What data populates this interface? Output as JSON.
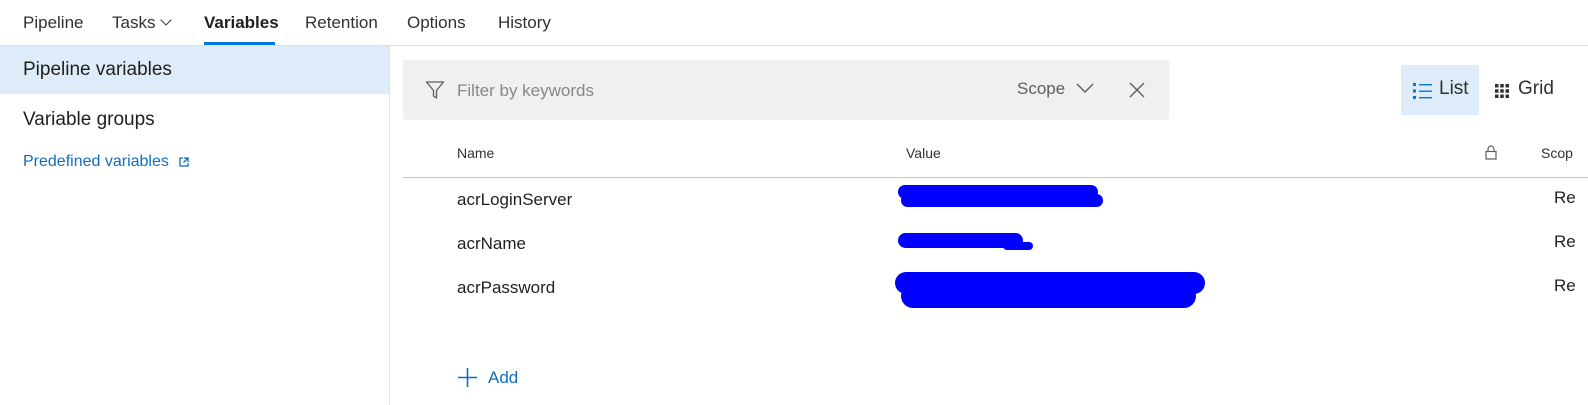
{
  "tabs": [
    {
      "label": "Pipeline"
    },
    {
      "label": "Tasks"
    },
    {
      "label": "Variables"
    },
    {
      "label": "Retention"
    },
    {
      "label": "Options"
    },
    {
      "label": "History"
    }
  ],
  "active_tab": "Variables",
  "sidebar": {
    "items": [
      {
        "label": "Pipeline variables"
      },
      {
        "label": "Variable groups"
      }
    ],
    "predefined_link": "Predefined variables"
  },
  "filter": {
    "placeholder": "Filter by keywords",
    "scope_label": "Scope"
  },
  "view_toggle": {
    "list_label": "List",
    "grid_label": "Grid",
    "selected": "List"
  },
  "table": {
    "headers": {
      "name": "Name",
      "value": "Value",
      "scope": "Scop"
    },
    "rows": [
      {
        "name": "acrLoginServer",
        "scope": "Re"
      },
      {
        "name": "acrName",
        "scope": "Re"
      },
      {
        "name": "acrPassword",
        "scope": "Re"
      }
    ]
  },
  "add_label": "Add",
  "colors": {
    "accent": "#0078d4",
    "link": "#106ebe",
    "selected_bg": "#deecf9",
    "filter_bg": "#f0f0f0",
    "redaction": "#0000ff"
  }
}
